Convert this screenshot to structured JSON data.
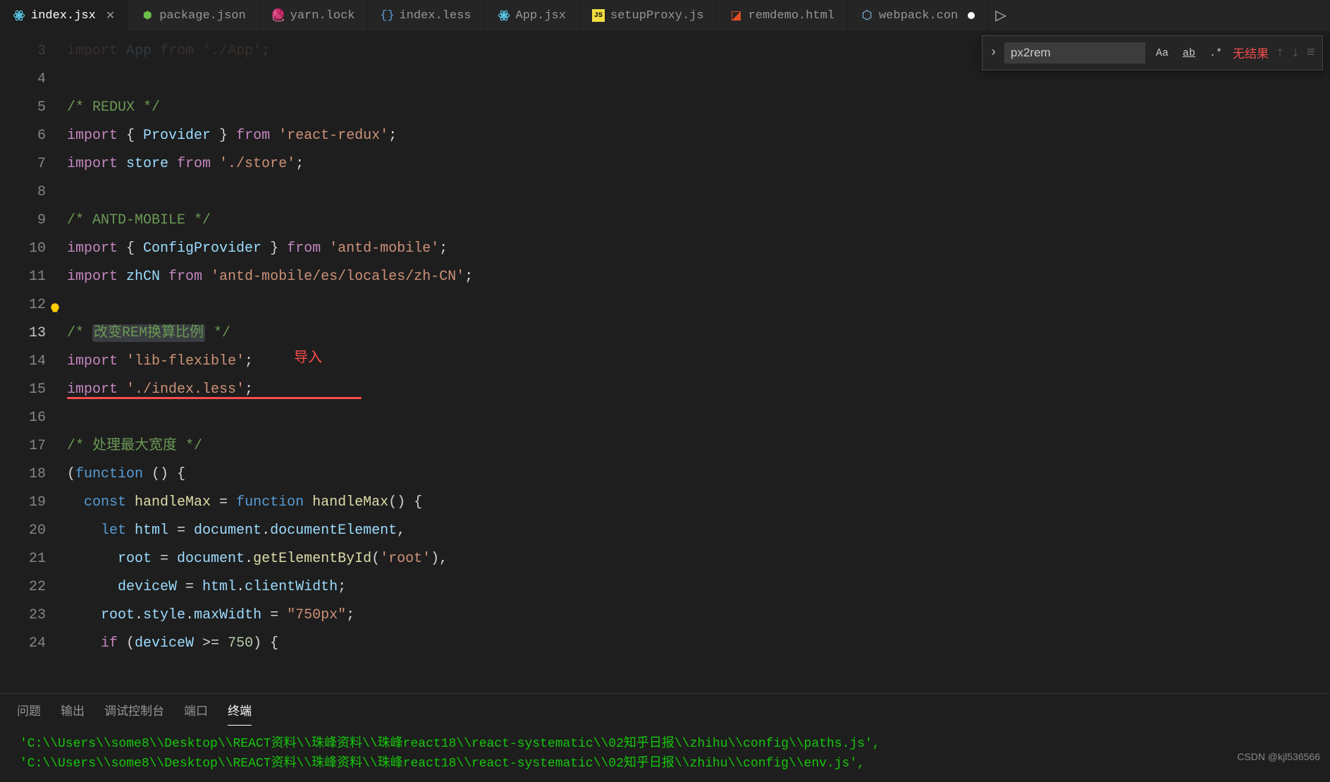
{
  "tabs": [
    {
      "label": "index.jsx",
      "icon": "react",
      "active": true,
      "closable": true
    },
    {
      "label": "package.json",
      "icon": "npm"
    },
    {
      "label": "yarn.lock",
      "icon": "yarn"
    },
    {
      "label": "index.less",
      "icon": "less"
    },
    {
      "label": "App.jsx",
      "icon": "react"
    },
    {
      "label": "setupProxy.js",
      "icon": "js"
    },
    {
      "label": "remdemo.html",
      "icon": "html"
    },
    {
      "label": "webpack.con",
      "icon": "webpack",
      "dirty": true
    }
  ],
  "find": {
    "value": "px2rem",
    "result": "无结果",
    "case": "Aa",
    "word": "ab",
    "regex": ".*"
  },
  "gutter": {
    "start": 3,
    "end": 25,
    "current": 13,
    "breakpoint": 15,
    "bulb": 12
  },
  "annotation": {
    "text": "导入"
  },
  "code": {
    "l3": "import App from './App';",
    "l5": "/* REDUX */",
    "l6a": "import",
    "l6b": " { ",
    "l6c": "Provider",
    "l6d": " } ",
    "l6e": "from",
    "l6f": " 'react-redux'",
    "l6g": ";",
    "l7a": "import ",
    "l7b": "store",
    "l7c": " from",
    "l7d": " './store'",
    "l7e": ";",
    "l9": "/* ANTD-MOBILE */",
    "l10a": "import",
    "l10b": " { ",
    "l10c": "ConfigProvider",
    "l10d": " } ",
    "l10e": "from",
    "l10f": " 'antd-mobile'",
    "l10g": ";",
    "l11a": "import ",
    "l11b": "zhCN",
    "l11c": " from",
    "l11d": " 'antd-mobile/es/locales/zh-CN'",
    "l11e": ";",
    "l13a": "/* ",
    "l13b": "改变REM换算比例",
    "l13c": " */",
    "l14a": "import",
    "l14b": " 'lib-flexible'",
    "l14c": ";",
    "l15a": "import",
    "l15b": " './index.less'",
    "l15c": ";",
    "l17": "/* 处理最大宽度 */",
    "l18a": "(",
    "l18b": "function",
    "l18c": " () {",
    "l19a": "  const ",
    "l19b": "handleMax",
    "l19c": " = ",
    "l19d": "function",
    "l19e": " ",
    "l19f": "handleMax",
    "l19g": "() {",
    "l20a": "    let ",
    "l20b": "html",
    "l20c": " = ",
    "l20d": "document",
    "l20e": ".",
    "l20f": "documentElement",
    "l20g": ",",
    "l21a": "      ",
    "l21b": "root",
    "l21c": " = ",
    "l21d": "document",
    "l21e": ".",
    "l21f": "getElementById",
    "l21g": "(",
    "l21h": "'root'",
    "l21i": "),",
    "l22a": "      ",
    "l22b": "deviceW",
    "l22c": " = ",
    "l22d": "html",
    "l22e": ".",
    "l22f": "clientWidth",
    "l22g": ";",
    "l23a": "    ",
    "l23b": "root",
    "l23c": ".",
    "l23d": "style",
    "l23e": ".",
    "l23f": "maxWidth",
    "l23g": " = ",
    "l23h": "\"750px\"",
    "l23i": ";",
    "l24a": "    if",
    "l24b": " (",
    "l24c": "deviceW",
    "l24d": " >= ",
    "l24e": "750",
    "l24f": ") {"
  },
  "panel": {
    "tabs": [
      "问题",
      "输出",
      "调试控制台",
      "端口",
      "终端"
    ],
    "active": 4,
    "lines": [
      "'C:\\\\Users\\\\some8\\\\Desktop\\\\REACT资料\\\\珠峰资料\\\\珠峰react18\\\\react-systematic\\\\02知乎日报\\\\zhihu\\\\config\\\\paths.js',",
      "'C:\\\\Users\\\\some8\\\\Desktop\\\\REACT资料\\\\珠峰资料\\\\珠峰react18\\\\react-systematic\\\\02知乎日报\\\\zhihu\\\\config\\\\env.js',"
    ]
  },
  "watermark": "CSDN @kjl536566"
}
